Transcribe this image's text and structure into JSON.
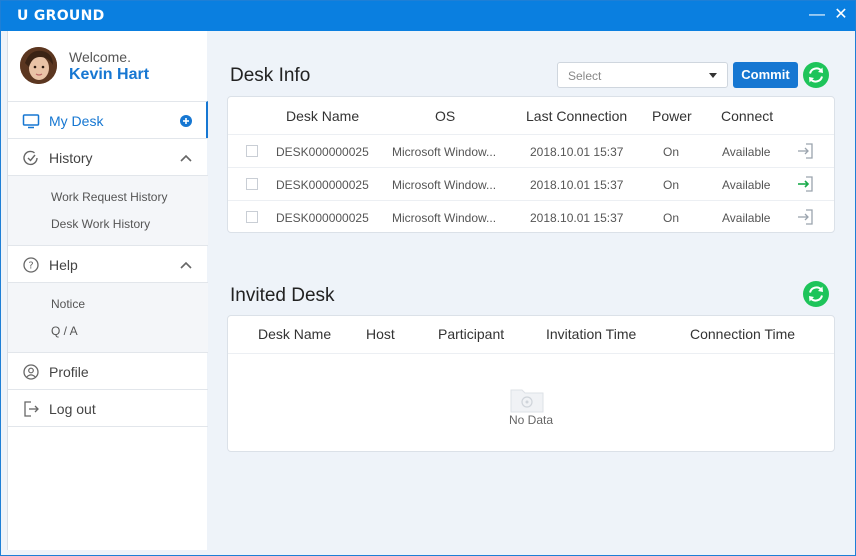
{
  "app": {
    "title": "U GROUND"
  },
  "window_controls": {
    "minimize": "—",
    "close": "✕"
  },
  "user": {
    "welcome": "Welcome.",
    "name": "Kevin Hart"
  },
  "sidebar": {
    "my_desk": "My Desk",
    "history": "History",
    "history_items": [
      "Work Request  History",
      "Desk Work History"
    ],
    "help": "Help",
    "help_items": [
      "Notice",
      "Q / A"
    ],
    "profile": "Profile",
    "logout": "Log out"
  },
  "desk_info": {
    "title": "Desk Info",
    "select_placeholder": "Select",
    "commit": "Commit",
    "columns": [
      "Desk Name",
      "OS",
      "Last Connection",
      "Power",
      "Connect"
    ],
    "rows": [
      {
        "name": "DESK000000025",
        "os": "Microsoft Window...",
        "last": "2018.10.01 15:37",
        "power": "On",
        "connect": "Available",
        "icon_color": "#9aa3ad"
      },
      {
        "name": "DESK000000025",
        "os": "Microsoft Window...",
        "last": "2018.10.01 15:37",
        "power": "On",
        "connect": "Available",
        "icon_color": "#1aab4b"
      },
      {
        "name": "DESK000000025",
        "os": "Microsoft Window...",
        "last": "2018.10.01 15:37",
        "power": "On",
        "connect": "Available",
        "icon_color": "#9aa3ad"
      }
    ]
  },
  "invited_desk": {
    "title": "Invited Desk",
    "columns": [
      "Desk Name",
      "Host",
      "Participant",
      "Invitation Time",
      "Connection Time"
    ],
    "empty_text": "No Data"
  },
  "colors": {
    "accent": "#1677d2",
    "titlebar": "#0a7fe0",
    "refresh": "#1ec45a"
  },
  "icons": {
    "my_desk": "monitor-icon",
    "add": "plus-circle-icon",
    "history": "history-icon",
    "help": "question-circle-icon",
    "profile": "user-icon",
    "logout": "logout-icon",
    "refresh": "refresh-icon",
    "connect": "sign-in-icon",
    "empty": "empty-folder-icon"
  }
}
